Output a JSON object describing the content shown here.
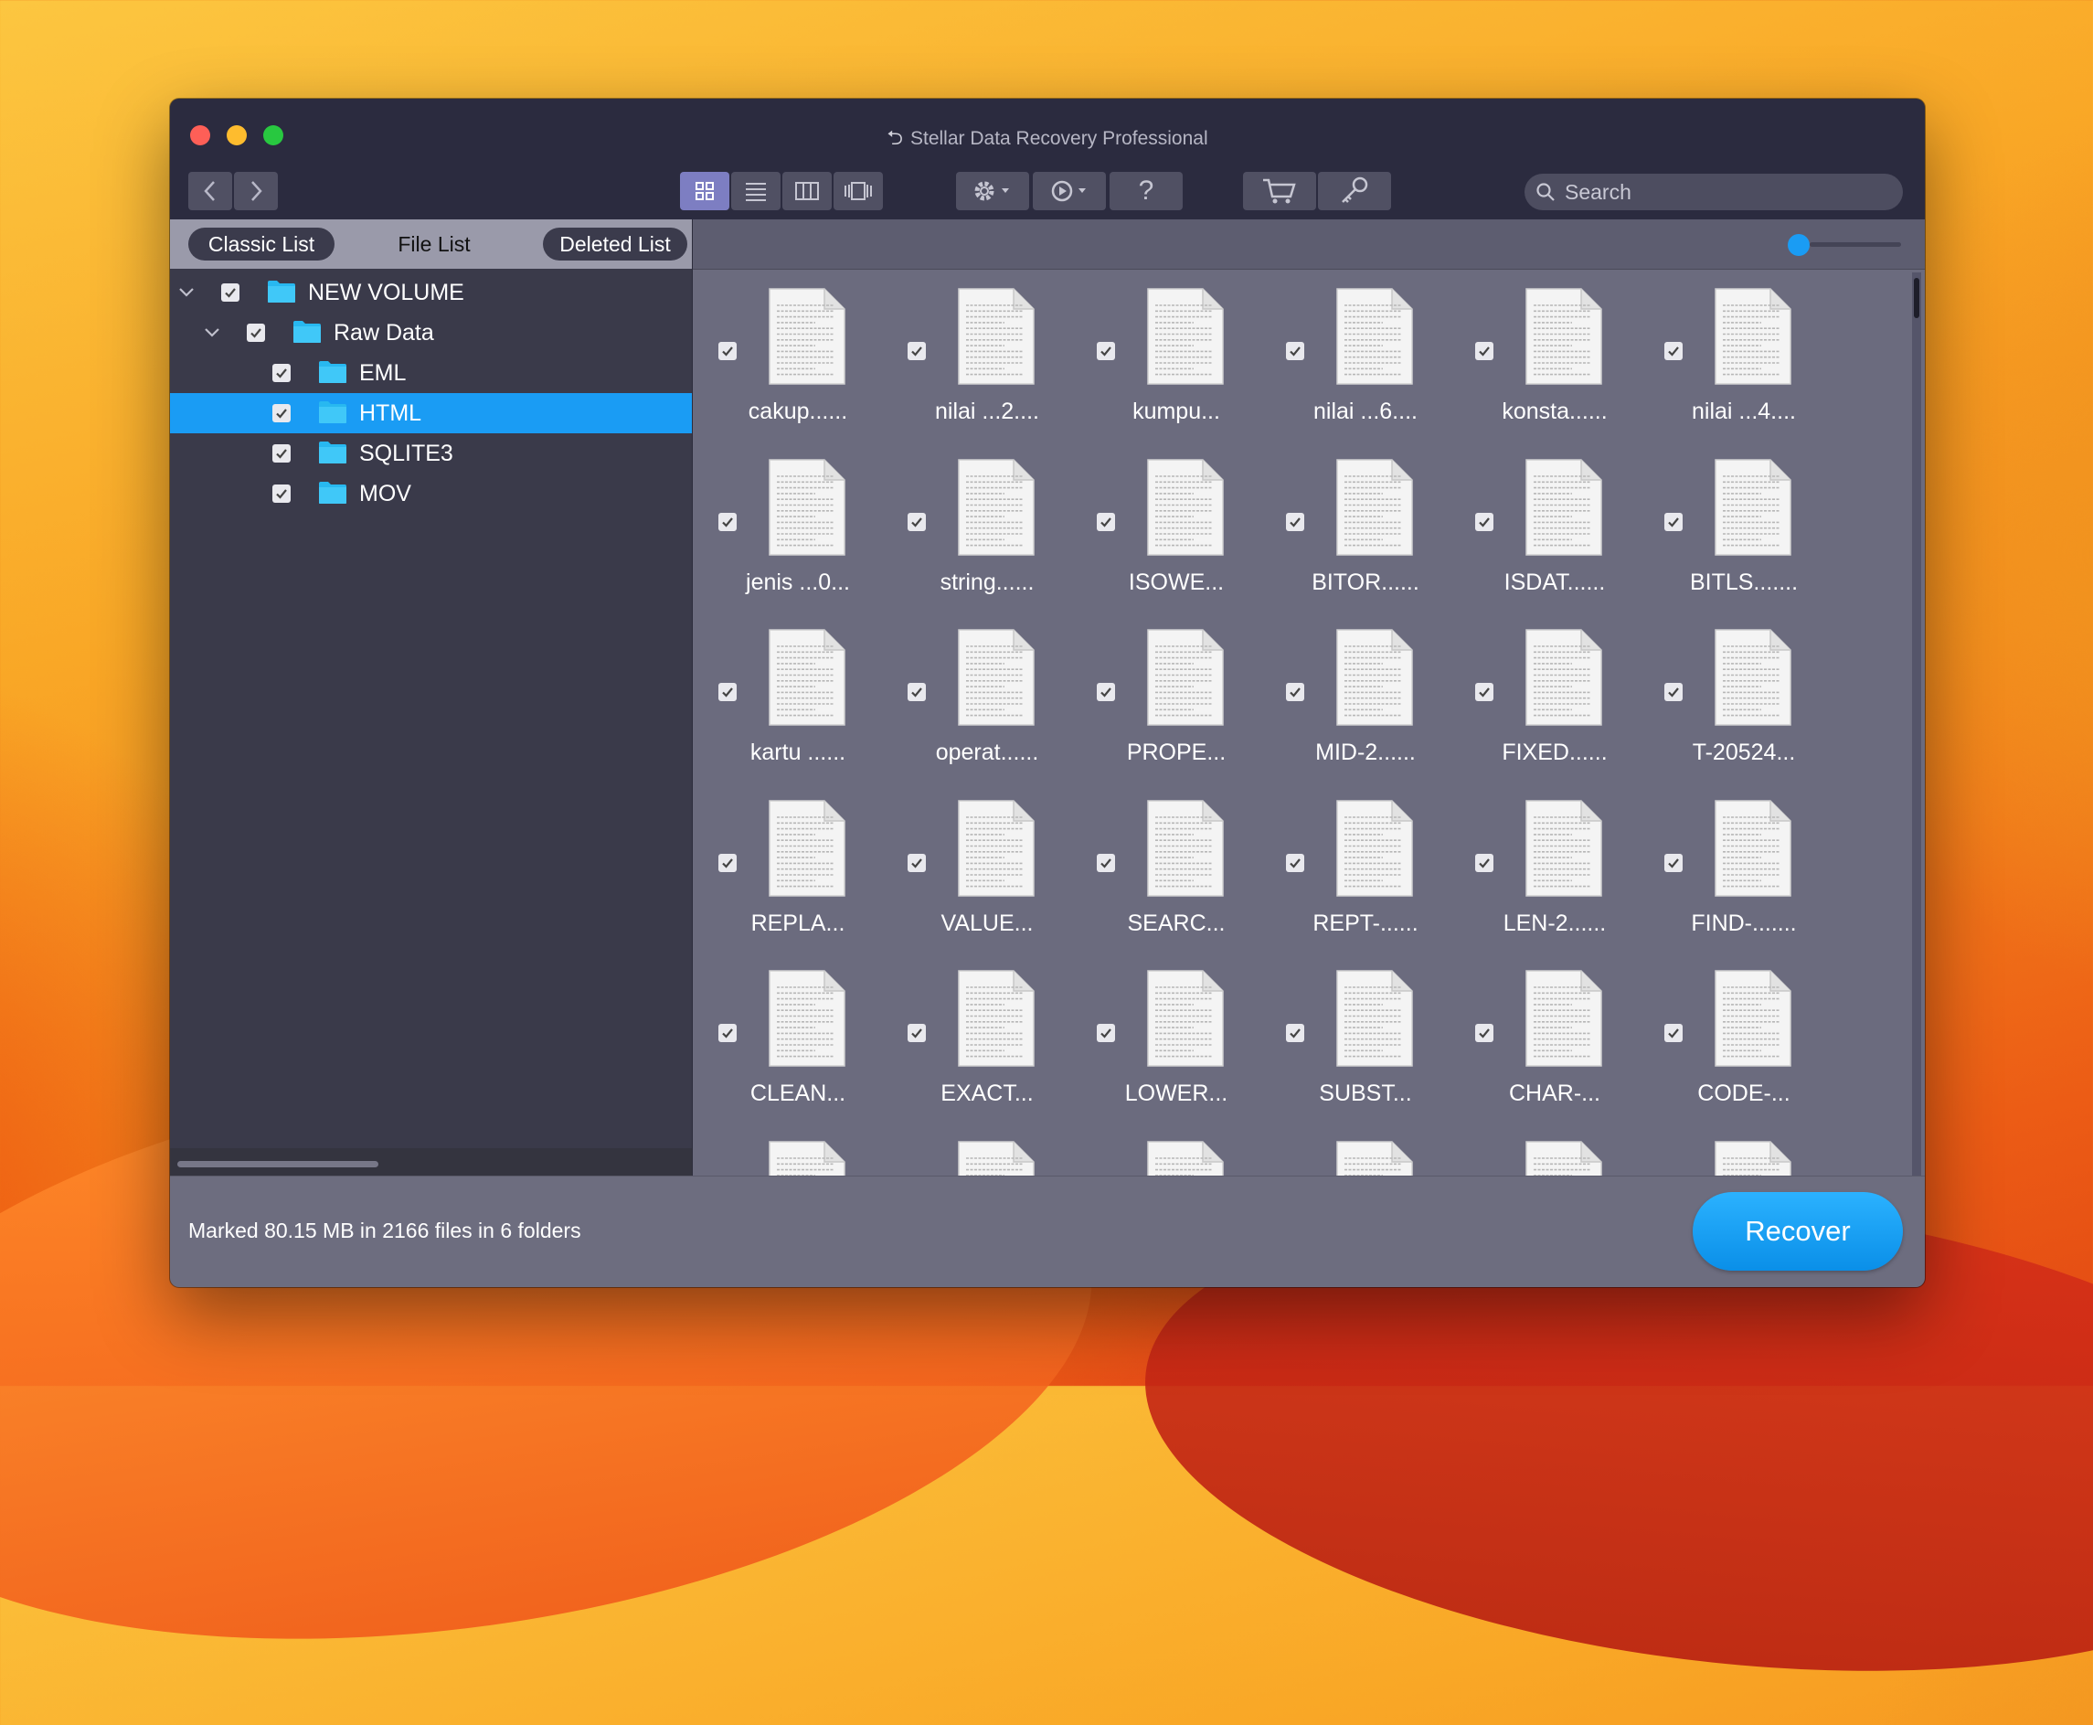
{
  "window": {
    "title": "Stellar Data Recovery Professional",
    "colors": {
      "selection": "#1a9cf4",
      "recover_button": "#1a9cf4",
      "view_active": "#7d7ec2"
    }
  },
  "toolbar": {
    "back_icon": "chevron-left-icon",
    "forward_icon": "chevron-right-icon",
    "view_modes": [
      "icon-view",
      "list-view",
      "column-view",
      "coverflow-view"
    ],
    "active_view": "icon-view",
    "settings_icon": "gear-icon",
    "history_icon": "history-icon",
    "help_label": "?",
    "cart_icon": "cart-icon",
    "key_icon": "key-icon",
    "search_placeholder": "Search"
  },
  "tabs": {
    "classic": "Classic List",
    "file": "File List",
    "deleted": "Deleted List",
    "active": "Classic List"
  },
  "tree": [
    {
      "label": "NEW VOLUME",
      "level": 0,
      "expandable": true,
      "checked": true,
      "selected": false
    },
    {
      "label": "Raw Data",
      "level": 1,
      "expandable": true,
      "checked": true,
      "selected": false
    },
    {
      "label": "EML",
      "level": 2,
      "expandable": false,
      "checked": true,
      "selected": false
    },
    {
      "label": "HTML",
      "level": 2,
      "expandable": false,
      "checked": true,
      "selected": true
    },
    {
      "label": "SQLITE3",
      "level": 2,
      "expandable": false,
      "checked": true,
      "selected": false
    },
    {
      "label": "MOV",
      "level": 2,
      "expandable": false,
      "checked": true,
      "selected": false
    }
  ],
  "files": [
    "cakup......",
    "nilai ...2....",
    "kumpu...",
    "nilai ...6....",
    "konsta......",
    "nilai ...4....",
    "jenis ...0...",
    "string......",
    "ISOWE...",
    "BITOR......",
    "ISDAT......",
    "BITLS.......",
    "kartu ......",
    "operat......",
    "PROPE...",
    "MID-2......",
    "FIXED......",
    "T-20524...",
    "REPLA...",
    "VALUE...",
    "SEARC...",
    "REPT-......",
    "LEN-2......",
    "FIND-.......",
    "CLEAN...",
    "EXACT...",
    "LOWER...",
    "SUBST...",
    "CHAR-...",
    "CODE-...",
    "",
    "",
    "",
    "",
    "",
    ""
  ],
  "zoom_level": 0.0,
  "status": {
    "text": "Marked 80.15 MB in 2166 files in 6 folders"
  },
  "recover_label": "Recover"
}
